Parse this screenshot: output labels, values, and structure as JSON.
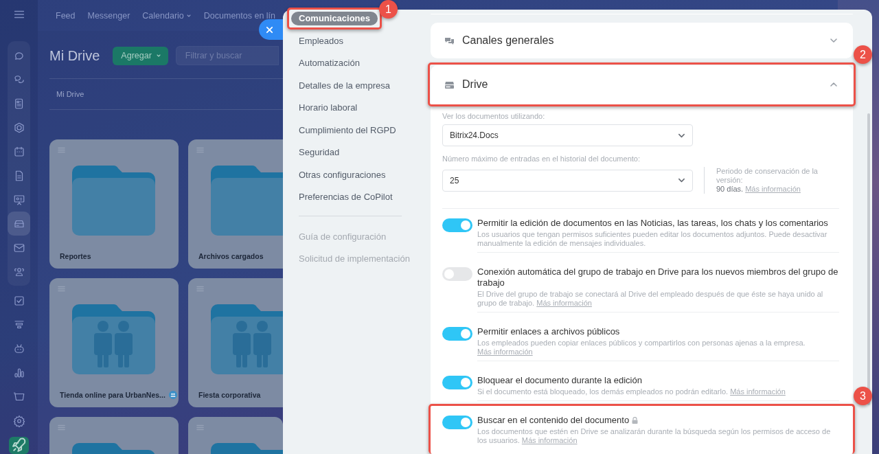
{
  "rail": [
    {
      "selected": false
    },
    {
      "selected": false
    },
    {
      "selected": false
    },
    {
      "selected": false
    },
    {
      "selected": false
    },
    {
      "selected": false
    },
    {
      "selected": false
    },
    {
      "selected": true
    },
    {
      "selected": false
    },
    {
      "selected": false
    },
    {
      "selected": false
    },
    {
      "selected": false
    },
    {
      "selected": false
    },
    {
      "selected": false
    },
    {
      "selected": false
    },
    {
      "selected": false
    }
  ],
  "top_nav": [
    {
      "label": "Feed",
      "dropdown": false
    },
    {
      "label": "Messenger",
      "dropdown": false
    },
    {
      "label": "Calendario",
      "dropdown": true
    },
    {
      "label": "Documentos en lín",
      "dropdown": false
    }
  ],
  "drive_page": {
    "title": "Mi Drive",
    "add_button": "Agregar",
    "search": {
      "placeholder": "Filtrar y buscar"
    },
    "breadcrumb": "Mi Drive",
    "folders": [
      {
        "name": "Reportes",
        "kind": "plain",
        "shared_badge": false
      },
      {
        "name": "Archivos cargados",
        "kind": "plain",
        "shared_badge": false
      },
      {
        "name": "Tienda online para UrbanNes...",
        "kind": "shared",
        "shared_badge": true
      },
      {
        "name": "Fiesta corporativa",
        "kind": "shared",
        "shared_badge": false
      },
      {
        "kind": "plain"
      },
      {
        "kind": "plain"
      }
    ]
  },
  "settings": {
    "nav": [
      {
        "label": "Comunicaciones",
        "selected": true,
        "callout": "1"
      },
      {
        "label": "Empleados",
        "selected": false
      },
      {
        "label": "Automatización",
        "selected": false
      },
      {
        "label": "Detalles de la empresa",
        "selected": false
      },
      {
        "label": "Horario laboral",
        "selected": false
      },
      {
        "label": "Cumplimiento del RGPD",
        "selected": false
      },
      {
        "label": "Seguridad",
        "selected": false
      },
      {
        "label": "Otras configuraciones",
        "selected": false
      },
      {
        "label": "Preferencias de CoPilot",
        "selected": false
      }
    ],
    "secondary_nav": [
      {
        "label": "Guía de configuración"
      },
      {
        "label": "Solicitud de implementación"
      }
    ],
    "sections": [
      {
        "title": "Canales generales",
        "kind": "channels",
        "expanded": false
      },
      {
        "title": "Drive",
        "kind": "drive",
        "expanded": true,
        "callout": "2",
        "body": {
          "selects": [
            {
              "label": "Ver los documentos utilizando:",
              "value": "Bitrix24.Docs"
            },
            {
              "label": "Número máximo de entradas en el historial del documento:",
              "value": "25",
              "note": {
                "label": "Periodo de conservación de la versión:",
                "value": "90 días.",
                "link": "Más información"
              }
            }
          ],
          "options": [
            {
              "title": "Permitir la edición de documentos en las Noticias, las tareas, los chats y los comentarios",
              "on": true,
              "description": "Los usuarios que tengan permisos suficientes pueden editar los documentos adjuntos. Puede desactivar manualmente la edición de mensajes individuales."
            },
            {
              "title": "Conexión automática del grupo de trabajo en Drive para los nuevos miembros del grupo de trabajo",
              "on": false,
              "description": "El Drive del grupo de trabajo se conectará al Drive del empleado después de que éste se haya unido al grupo de trabajo.",
              "link": "Más información"
            },
            {
              "title": "Permitir enlaces a archivos públicos",
              "on": true,
              "description": "Los empleados pueden copiar enlaces públicos y compartirlos con personas ajenas a la empresa.",
              "link": "Más información"
            },
            {
              "title": "Bloquear el documento durante la edición",
              "on": true,
              "description": "Si el documento está bloqueado, los demás empleados no podrán editarlo.",
              "link": "Más información"
            },
            {
              "title": "Buscar en el contenido del documento",
              "on": true,
              "locked": true,
              "callout": "3",
              "description": "Los documentos que estén en Drive se analizarán durante la búsqueda según los permisos de acceso de los usuarios.",
              "link": "Más información"
            }
          ]
        }
      }
    ]
  }
}
